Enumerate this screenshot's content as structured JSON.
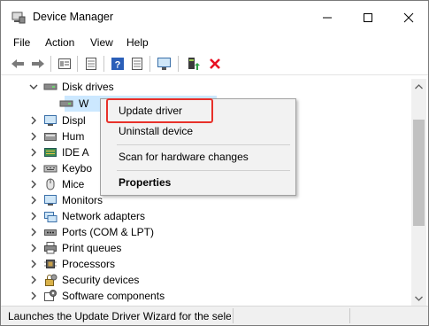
{
  "window": {
    "title": "Device Manager",
    "controls": {
      "minimize": "minimize",
      "maximize": "maximize",
      "close": "close"
    }
  },
  "menu": [
    "File",
    "Action",
    "View",
    "Help"
  ],
  "toolbar": {
    "icons": [
      "back-icon",
      "forward-icon",
      "properties-view-icon",
      "list-view-icon",
      "help-icon",
      "monitor-icon",
      "update-driver-icon",
      "uninstall-icon"
    ],
    "uninstall_color": "#e81123"
  },
  "tree": {
    "items": [
      {
        "label": "Disk drives",
        "expanded": true,
        "icon": "disk-drive-icon"
      },
      {
        "label": "W",
        "child": true,
        "selected": true,
        "icon": "disk-icon"
      },
      {
        "label": "Displ",
        "icon": "display-adapter-icon"
      },
      {
        "label": "Hum",
        "icon": "hid-icon"
      },
      {
        "label": "IDE A",
        "icon": "ide-icon"
      },
      {
        "label": "Keybo",
        "icon": "keyboard-icon"
      },
      {
        "label": "Mice",
        "icon": "mouse-icon"
      },
      {
        "label": "Monitors",
        "icon": "monitor-icon"
      },
      {
        "label": "Network adapters",
        "icon": "network-adapter-icon"
      },
      {
        "label": "Ports (COM & LPT)",
        "icon": "port-icon"
      },
      {
        "label": "Print queues",
        "icon": "printer-icon"
      },
      {
        "label": "Processors",
        "icon": "processor-icon"
      },
      {
        "label": "Security devices",
        "icon": "security-device-icon"
      },
      {
        "label": "Software components",
        "icon": "software-component-icon"
      }
    ]
  },
  "context_menu": {
    "update_driver": "Update driver",
    "uninstall_device": "Uninstall device",
    "scan_changes": "Scan for hardware changes",
    "properties": "Properties",
    "highlight_color": "#e8312a"
  },
  "status": {
    "text": "Launches the Update Driver Wizard for the selec"
  }
}
